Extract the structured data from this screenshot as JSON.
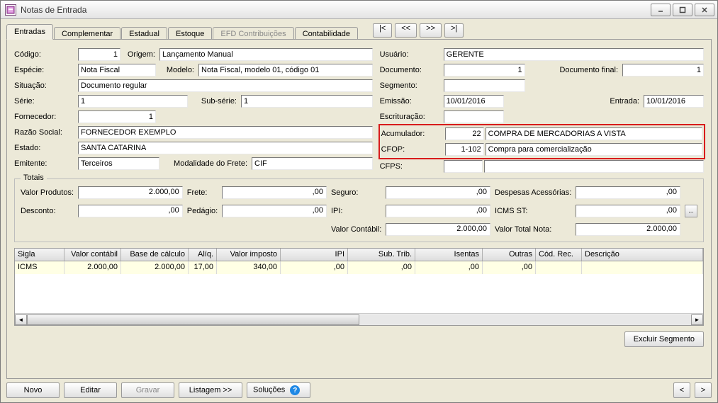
{
  "window": {
    "title": "Notas de Entrada"
  },
  "tabs": [
    "Entradas",
    "Complementar",
    "Estadual",
    "Estoque",
    "EFD Contribuições",
    "Contabilidade"
  ],
  "nav": [
    "|<",
    "<<",
    ">>",
    ">|"
  ],
  "form": {
    "codigo_lbl": "Código:",
    "codigo": "1",
    "origem_lbl": "Origem:",
    "origem": "Lançamento Manual",
    "especie_lbl": "Espécie:",
    "especie": "Nota Fiscal",
    "modelo_lbl": "Modelo:",
    "modelo": "Nota Fiscal, modelo 01, código 01",
    "situacao_lbl": "Situação:",
    "situacao": "Documento regular",
    "serie_lbl": "Série:",
    "serie": "1",
    "subserie_lbl": "Sub-série:",
    "subserie": "1",
    "fornecedor_lbl": "Fornecedor:",
    "fornecedor": "1",
    "razao_lbl": "Razão Social:",
    "razao": "FORNECEDOR EXEMPLO",
    "estado_lbl": "Estado:",
    "estado": "SANTA CATARINA",
    "emitente_lbl": "Emitente:",
    "emitente": "Terceiros",
    "modfrete_lbl": "Modalidade do Frete:",
    "modfrete": "CIF",
    "usuario_lbl": "Usuário:",
    "usuario": "GERENTE",
    "documento_lbl": "Documento:",
    "documento": "1",
    "docfinal_lbl": "Documento final:",
    "docfinal": "1",
    "segmento_lbl": "Segmento:",
    "segmento": "",
    "emissao_lbl": "Emissão:",
    "emissao": "10/01/2016",
    "entrada_lbl": "Entrada:",
    "entrada": "10/01/2016",
    "escrituracao_lbl": "Escrituração:",
    "escrituracao": "",
    "acumulador_lbl": "Acumulador:",
    "acumulador_cod": "22",
    "acumulador_desc": "COMPRA DE MERCADORIAS A VISTA",
    "cfop_lbl": "CFOP:",
    "cfop_cod": "1-102",
    "cfop_desc": "Compra para comercialização",
    "cfps_lbl": "CFPS:",
    "cfps_cod": "",
    "cfps_desc": ""
  },
  "totais": {
    "legend": "Totais",
    "valor_produtos_lbl": "Valor Produtos:",
    "valor_produtos": "2.000,00",
    "frete_lbl": "Frete:",
    "frete": ",00",
    "seguro_lbl": "Seguro:",
    "seguro": ",00",
    "despesas_lbl": "Despesas Acessórias:",
    "despesas": ",00",
    "desconto_lbl": "Desconto:",
    "desconto": ",00",
    "pedagio_lbl": "Pedágio:",
    "pedagio": ",00",
    "ipi_lbl": "IPI:",
    "ipi": ",00",
    "icmsst_lbl": "ICMS ST:",
    "icmsst": ",00",
    "valor_contabil_lbl": "Valor Contábil:",
    "valor_contabil": "2.000,00",
    "valor_total_lbl": "Valor Total Nota:",
    "valor_total": "2.000,00"
  },
  "grid": {
    "headers": [
      "Sigla",
      "Valor contábil",
      "Base de cálculo",
      "Alíq.",
      "Valor imposto",
      "IPI",
      "Sub. Trib.",
      "Isentas",
      "Outras",
      "Cód. Rec.",
      "Descrição"
    ],
    "row": [
      "ICMS",
      "2.000,00",
      "2.000,00",
      "17,00",
      "340,00",
      ",00",
      ",00",
      ",00",
      ",00",
      "",
      ""
    ]
  },
  "buttons": {
    "excluir": "Excluir Segmento",
    "novo": "Novo",
    "editar": "Editar",
    "gravar": "Gravar",
    "listagem": "Listagem >>",
    "solucoes": "Soluções",
    "ellipsis": "..."
  }
}
